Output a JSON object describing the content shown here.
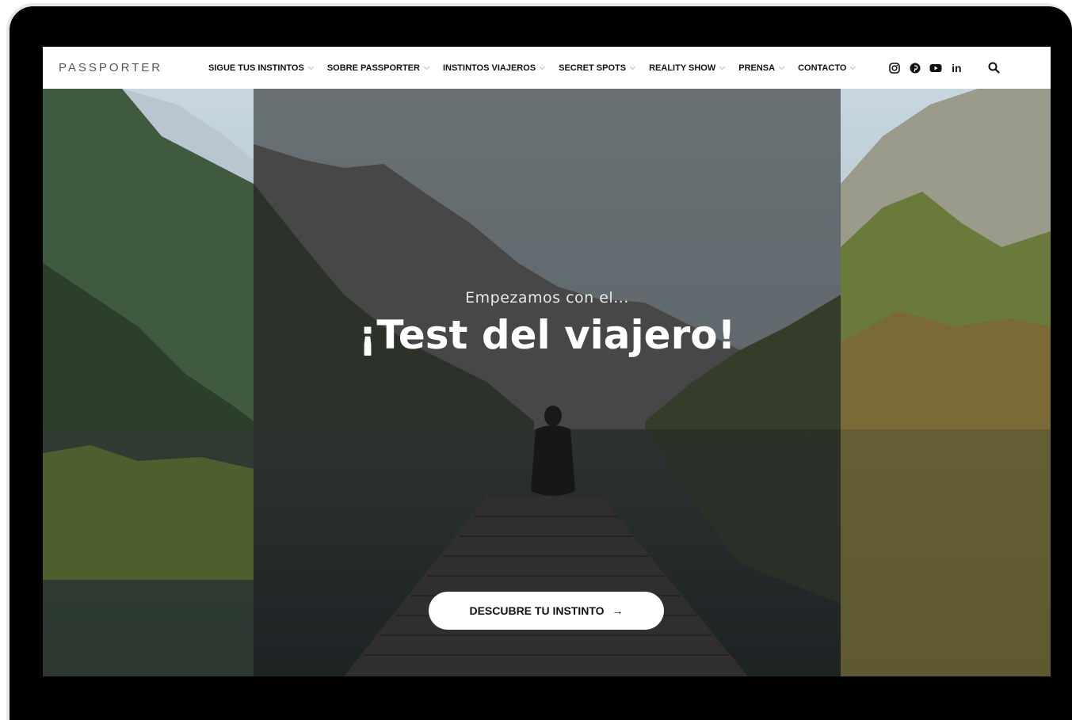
{
  "brand": {
    "logo": "PASSPORTER"
  },
  "nav": {
    "items": [
      {
        "label": "SIGUE TUS INSTINTOS"
      },
      {
        "label": "SOBRE PASSPORTER"
      },
      {
        "label": "INSTINTOS VIAJEROS"
      },
      {
        "label": "SECRET SPOTS"
      },
      {
        "label": "REALITY SHOW"
      },
      {
        "label": "PRENSA"
      },
      {
        "label": "CONTACTO"
      }
    ],
    "social_icons": [
      "instagram-icon",
      "pinterest-icon",
      "youtube-icon",
      "linkedin-icon"
    ],
    "linkedin_text": "in",
    "search_icon": "search-icon"
  },
  "hero": {
    "subtitle": "Empezamos con el...",
    "title": "¡Test del viajero!",
    "cta_label": "DESCUBRE TU INSTINTO",
    "cta_arrow": "→"
  },
  "colors": {
    "navbar_bg": "#ffffff",
    "overlay": "rgba(30,30,30,0.55)",
    "cta_bg": "#ffffff",
    "device_frame": "#000000"
  }
}
